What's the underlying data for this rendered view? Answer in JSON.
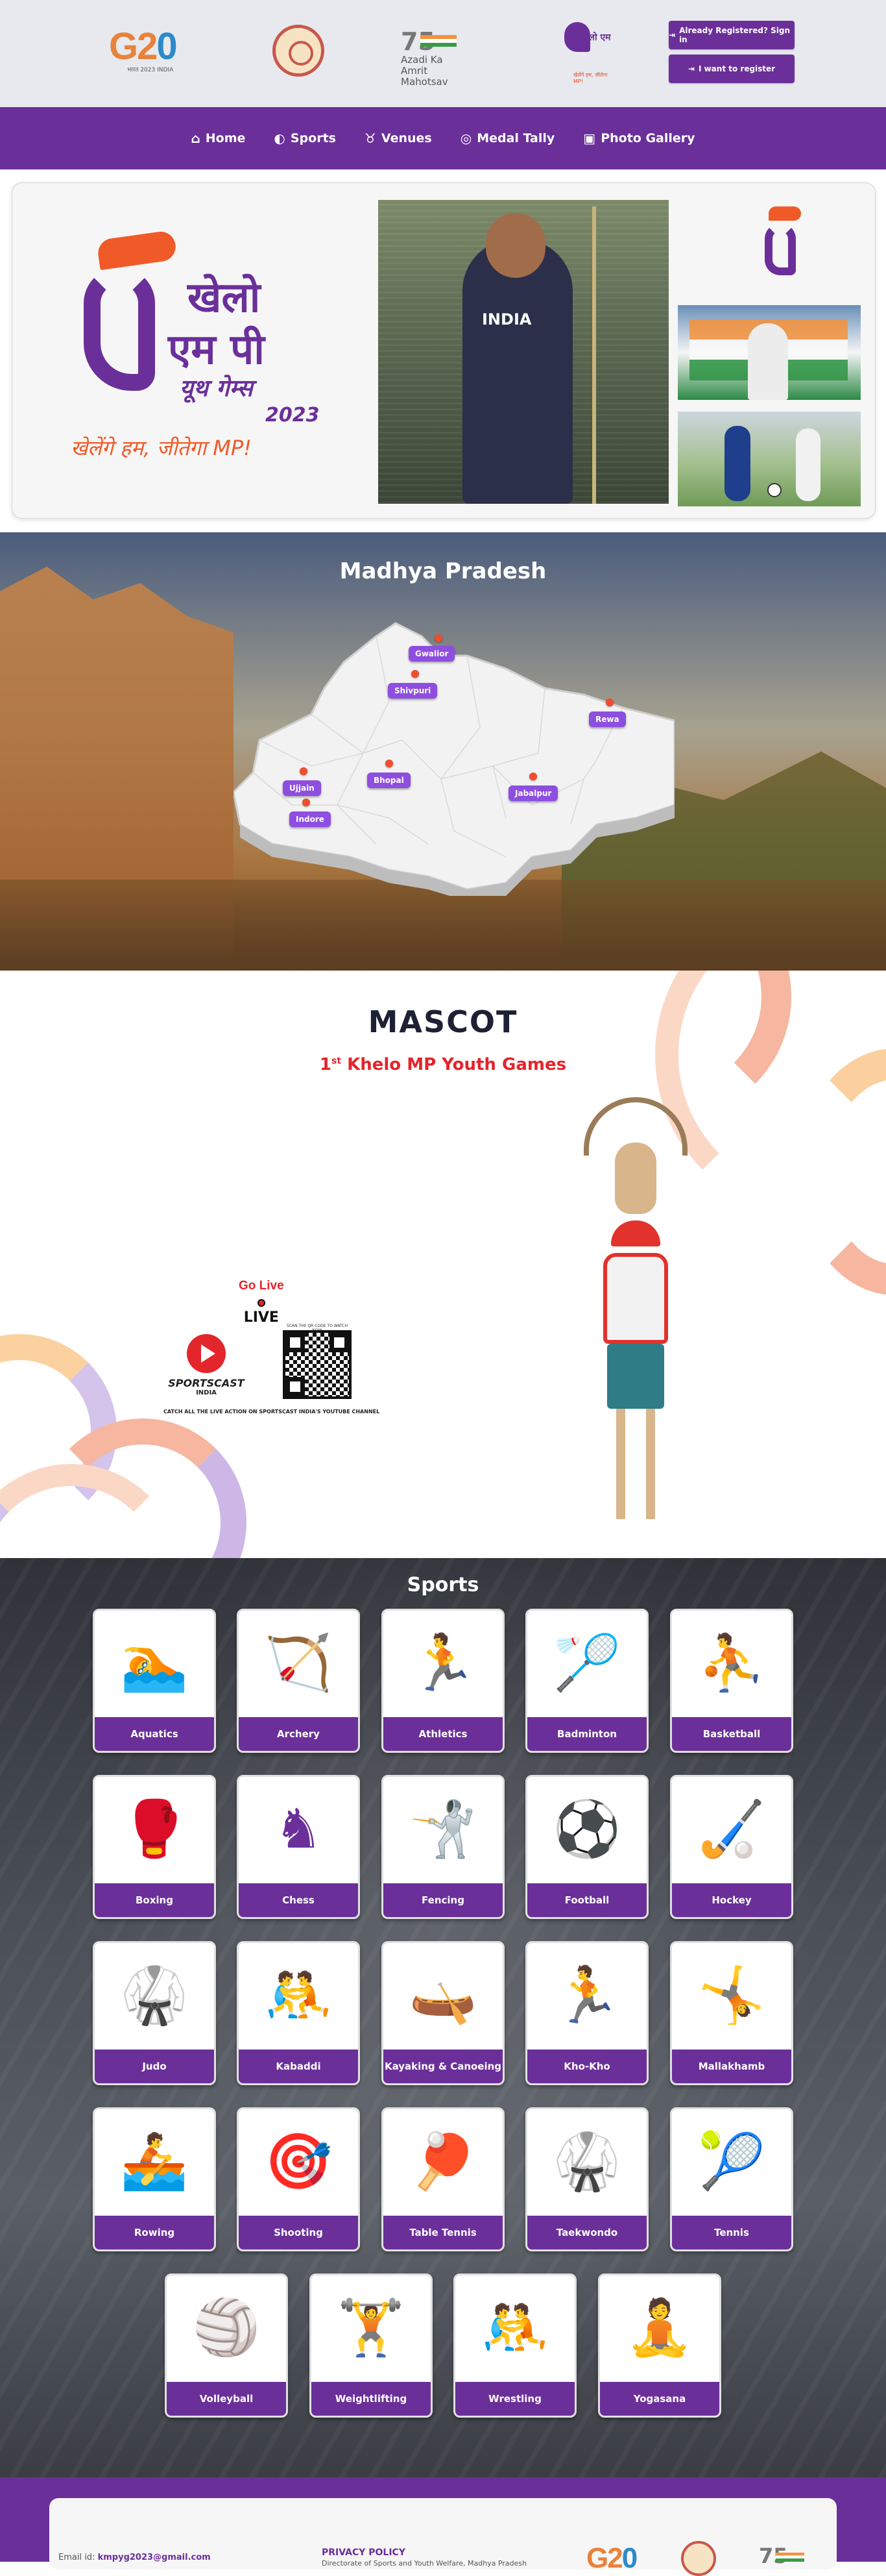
{
  "header": {
    "logos": {
      "g20_text": "G20",
      "g20_sub": "भारत 2023 INDIA",
      "azadi_75": "75",
      "azadi_line1": "Azadi",
      "azadi_line2": "Ka",
      "azadi_line3": "Amrit Mahotsav",
      "khelo_text": "खेलो एम पी",
      "khelo_sub": "खेलेंगे हम, जीतेगा MP!"
    },
    "signin_label": "Already Registered? Sign in",
    "register_label": "I want to register"
  },
  "nav": {
    "items": [
      {
        "icon": "⌂",
        "label": "Home"
      },
      {
        "icon": "◐",
        "label": "Sports"
      },
      {
        "icon": "♉",
        "label": "Venues"
      },
      {
        "icon": "◎",
        "label": "Medal Tally"
      },
      {
        "icon": "▣",
        "label": "Photo Gallery"
      }
    ]
  },
  "hero": {
    "logo_line1": "खेलो",
    "logo_line2": "एम पी",
    "logo_line3": "यूथ गेम्स",
    "logo_year": "2023",
    "logo_tagline": "खेलेंगे हम, जीतेगा MP!",
    "athlete_jersey": "INDIA"
  },
  "map": {
    "title": "Madhya Pradesh",
    "cities": [
      {
        "name": "Gwalior"
      },
      {
        "name": "Shivpuri"
      },
      {
        "name": "Rewa"
      },
      {
        "name": "Ujjain"
      },
      {
        "name": "Bhopal"
      },
      {
        "name": "Jabalpur"
      },
      {
        "name": "Indore"
      }
    ]
  },
  "mascot": {
    "title": "MASCOT",
    "subtitle_prefix": "1",
    "subtitle_sup": "st",
    "subtitle_rest": " Khelo MP Youth Games",
    "golive": "Go Live",
    "live": "LIVE",
    "qr_caption": "SCAN THE QR CODE TO WATCH NOW",
    "sportscast_name": "SPORTSCAST",
    "sportscast_country": "INDIA",
    "catch_text": "CATCH ALL THE LIVE ACTION ON SPORTSCAST INDIA'S YOUTUBE CHANNEL"
  },
  "sports": {
    "title": "Sports",
    "items": [
      {
        "label": "Aquatics",
        "icon": "🏊"
      },
      {
        "label": "Archery",
        "icon": "🏹"
      },
      {
        "label": "Athletics",
        "icon": "🏃"
      },
      {
        "label": "Badminton",
        "icon": "🏸"
      },
      {
        "label": "Basketball",
        "icon": "⛹"
      },
      {
        "label": "Boxing",
        "icon": "🥊"
      },
      {
        "label": "Chess",
        "icon": "♞"
      },
      {
        "label": "Fencing",
        "icon": "🤺"
      },
      {
        "label": "Football",
        "icon": "⚽"
      },
      {
        "label": "Hockey",
        "icon": "🏑"
      },
      {
        "label": "Judo",
        "icon": "🥋"
      },
      {
        "label": "Kabaddi",
        "icon": "🤼"
      },
      {
        "label": "Kayaking & Canoeing",
        "icon": "🛶"
      },
      {
        "label": "Kho-Kho",
        "icon": "🏃"
      },
      {
        "label": "Mallakhamb",
        "icon": "🤸"
      },
      {
        "label": "Rowing",
        "icon": "🚣"
      },
      {
        "label": "Shooting",
        "icon": "🎯"
      },
      {
        "label": "Table Tennis",
        "icon": "🏓"
      },
      {
        "label": "Taekwondo",
        "icon": "🥋"
      },
      {
        "label": "Tennis",
        "icon": "🎾"
      },
      {
        "label": "Volleyball",
        "icon": "🏐"
      },
      {
        "label": "Weightlifting",
        "icon": "🏋"
      },
      {
        "label": "Wrestling",
        "icon": "🤼"
      },
      {
        "label": "Yogasana",
        "icon": "🧘"
      }
    ]
  },
  "footer": {
    "email_label": "Email id:",
    "email": "kmpyg2023@gmail.com",
    "privacy": "PRIVACY POLICY",
    "directorate": "Directorate of Sports and Youth Welfare, Madhya Pradesh",
    "g20": "G20",
    "azadi": "75"
  },
  "colors": {
    "brand_purple": "#6b2f9a",
    "accent_orange": "#f05a28",
    "mascot_red": "#e3252c"
  }
}
